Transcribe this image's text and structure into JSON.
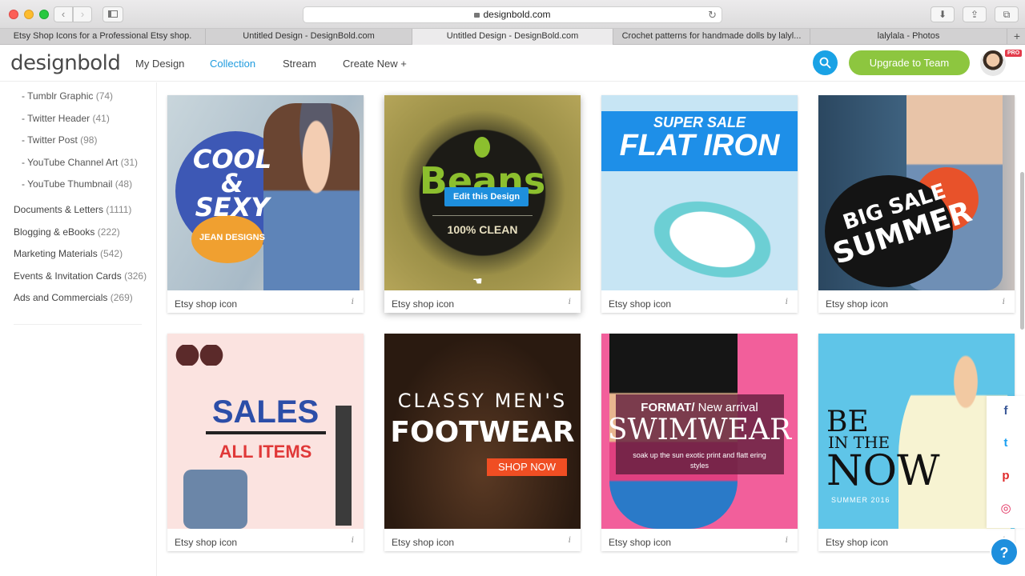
{
  "browser": {
    "url": "designbold.com",
    "tabs": [
      {
        "label": "Etsy Shop Icons for a Professional Etsy shop.",
        "active": false
      },
      {
        "label": "Untitled Design - DesignBold.com",
        "active": false
      },
      {
        "label": "Untitled Design - DesignBold.com",
        "active": true
      },
      {
        "label": "Crochet patterns for handmade dolls by lalyl...",
        "active": false
      },
      {
        "label": "lalylala - Photos",
        "active": false
      }
    ]
  },
  "header": {
    "logo": "designbold",
    "nav": [
      {
        "label": "My Design",
        "active": false
      },
      {
        "label": "Collection",
        "active": true
      },
      {
        "label": "Stream",
        "active": false
      },
      {
        "label": "Create New +",
        "active": false
      }
    ],
    "upgrade_label": "Upgrade to Team",
    "pro_badge": "PRO"
  },
  "sidebar": {
    "subcategories": [
      {
        "label": "- Tumblr Graphic",
        "count": "(74)"
      },
      {
        "label": "- Twitter Header",
        "count": "(41)"
      },
      {
        "label": "- Twitter Post",
        "count": "(98)"
      },
      {
        "label": "- YouTube Channel Art",
        "count": "(31)"
      },
      {
        "label": "- YouTube Thumbnail",
        "count": "(48)"
      }
    ],
    "categories": [
      {
        "label": "Documents & Letters",
        "count": "(1111)"
      },
      {
        "label": "Blogging & eBooks",
        "count": "(222)"
      },
      {
        "label": "Marketing Materials",
        "count": "(542)"
      },
      {
        "label": "Events & Invitation Cards",
        "count": "(326)"
      },
      {
        "label": "Ads and Commercials",
        "count": "(269)"
      }
    ]
  },
  "cards": [
    {
      "label": "Etsy shop icon",
      "art": {
        "line1": "COOL",
        "line2": "&",
        "line3": "SEXY",
        "line4": "JEAN DESIGNS"
      }
    },
    {
      "label": "Etsy shop icon",
      "art": {
        "line1": "Beans",
        "line2": "100% CLEAN"
      },
      "hover_button": "Edit this Design"
    },
    {
      "label": "Etsy shop icon",
      "art": {
        "line1": "SUPER SALE",
        "line2": "FLAT IRON"
      }
    },
    {
      "label": "Etsy shop icon",
      "art": {
        "line1": "BIG SALE",
        "line2": "SUMMER"
      }
    },
    {
      "label": "Etsy shop icon",
      "art": {
        "line1": "SALES",
        "line2": "ALL ITEMS"
      }
    },
    {
      "label": "Etsy shop icon",
      "art": {
        "line1": "CLASSY MEN'S",
        "line2": "FOOTWEAR",
        "button": "SHOP NOW"
      }
    },
    {
      "label": "Etsy shop icon",
      "art": {
        "line1a": "FORMAT/",
        "line1b": " New arrival",
        "line2": "SWIMWEAR",
        "line3": "soak up the sun exotic print and flatt ering styles"
      }
    },
    {
      "label": "Etsy shop icon",
      "art": {
        "line1": "BE",
        "line2": "IN THE",
        "line3": "NOW",
        "line4": "SUMMER 2016"
      }
    }
  ],
  "info_icon": "i",
  "social": [
    {
      "name": "facebook-icon",
      "glyph": "f",
      "color": "#3b5998"
    },
    {
      "name": "twitter-icon",
      "glyph": "t",
      "color": "#1da1f2"
    },
    {
      "name": "pinterest-icon",
      "glyph": "p",
      "color": "#e02a2a"
    },
    {
      "name": "instagram-icon",
      "glyph": "◎",
      "color": "#e02a5a"
    }
  ],
  "help_glyph": "?"
}
